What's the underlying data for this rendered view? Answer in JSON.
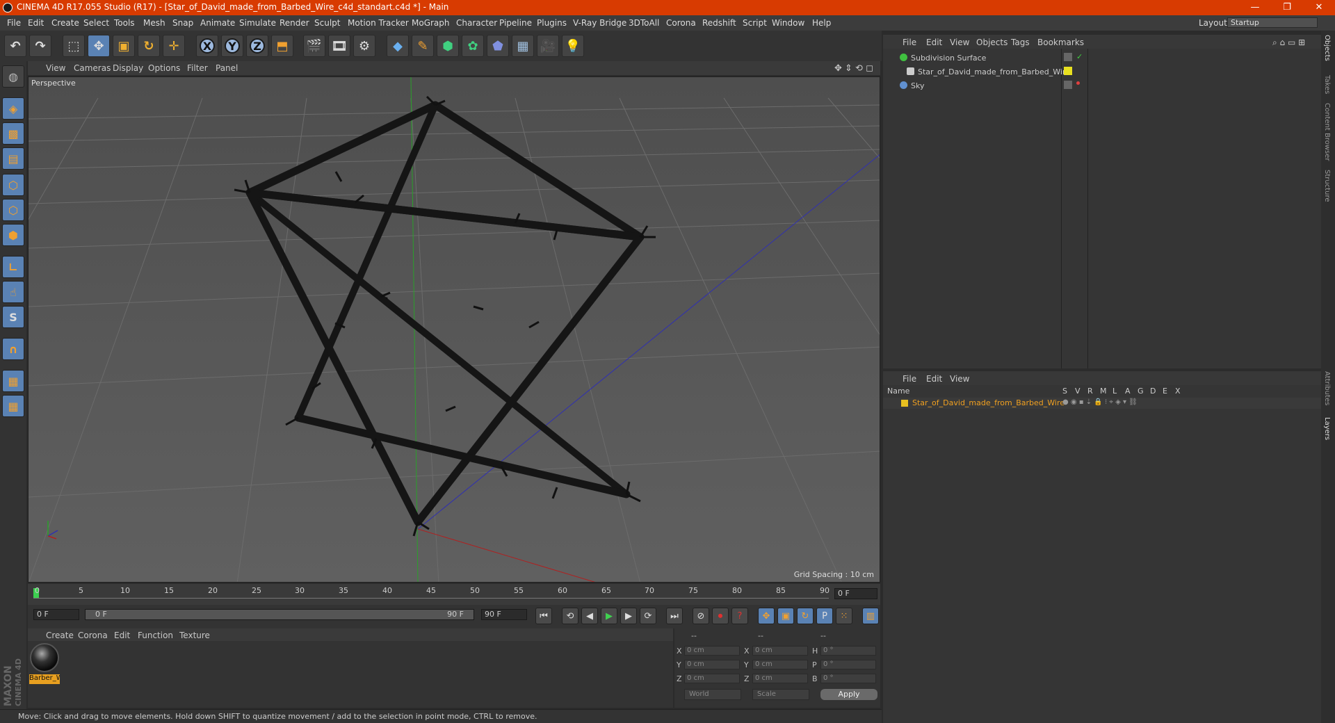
{
  "window": {
    "title": "CINEMA 4D R17.055 Studio (R17) - [Star_of_David_made_from_Barbed_Wire_c4d_standart.c4d *] - Main",
    "minimize": "—",
    "restore": "❐",
    "close": "✕"
  },
  "menubar": {
    "items": [
      "File",
      "Edit",
      "Create",
      "Select",
      "Tools",
      "Mesh",
      "Snap",
      "Animate",
      "Simulate",
      "Render",
      "Sculpt",
      "Motion Tracker",
      "MoGraph",
      "Character",
      "Pipeline",
      "Plugins",
      "V-Ray Bridge",
      "3DToAll",
      "Corona",
      "Redshift",
      "Script",
      "Window",
      "Help"
    ],
    "layout_label": "Layout:",
    "layout_value": "Startup"
  },
  "toolbar": {
    "axis_x": "X",
    "axis_y": "Y",
    "axis_z": "Z"
  },
  "viewport": {
    "menu": [
      "View",
      "Cameras",
      "Display",
      "Options",
      "Filter",
      "Panel"
    ],
    "camera_label": "Perspective",
    "grid_spacing": "Grid Spacing : 10 cm",
    "axis_colors": {
      "x": "#c02020",
      "y": "#20a020",
      "z": "#2020c0"
    }
  },
  "timeline": {
    "ticks": [
      "0",
      "5",
      "10",
      "15",
      "20",
      "25",
      "30",
      "35",
      "40",
      "45",
      "50",
      "55",
      "60",
      "65",
      "70",
      "75",
      "80",
      "85",
      "90"
    ],
    "current_frame": "0 F"
  },
  "transport": {
    "start_frame": "0 F",
    "range_start": "0 F",
    "range_end": "90 F",
    "end_frame": "90 F"
  },
  "material_manager": {
    "menu": [
      "Create",
      "Corona",
      "Edit",
      "Function",
      "Texture"
    ],
    "materials": [
      {
        "name": "Barber_W"
      }
    ]
  },
  "coordinates": {
    "header": [
      "--",
      "--",
      "--"
    ],
    "rows": [
      {
        "pos_label": "X",
        "pos": "0 cm",
        "size_label": "X",
        "size": "0 cm",
        "rot_label": "H",
        "rot": "0 °"
      },
      {
        "pos_label": "Y",
        "pos": "0 cm",
        "size_label": "Y",
        "size": "0 cm",
        "rot_label": "P",
        "rot": "0 °"
      },
      {
        "pos_label": "Z",
        "pos": "0 cm",
        "size_label": "Z",
        "size": "0 cm",
        "rot_label": "B",
        "rot": "0 °"
      }
    ],
    "mode": "World",
    "transform": "Scale",
    "apply": "Apply"
  },
  "object_manager": {
    "menu": [
      "File",
      "Edit",
      "View",
      "Objects",
      "Tags",
      "Bookmarks"
    ],
    "objects": [
      {
        "name": "Subdivision Surface",
        "color": "#40c040"
      },
      {
        "name": "Star_of_David_made_from_Barbed_Wire",
        "color": "#e8e020"
      },
      {
        "name": "Sky",
        "color": "#6090d0"
      }
    ]
  },
  "layer_manager": {
    "menu": [
      "File",
      "Edit",
      "View"
    ],
    "columns": [
      "Name",
      "S",
      "V",
      "R",
      "M",
      "L",
      "A",
      "G",
      "D",
      "E",
      "X"
    ],
    "layers": [
      {
        "name": "Star_of_David_made_from_Barbed_Wire",
        "color": "#e8c020"
      }
    ]
  },
  "side_tabs": [
    "Objects",
    "Takes",
    "Content Browser",
    "Structure",
    "Attributes",
    "Layers"
  ],
  "status": {
    "text": "Move: Click and drag to move elements. Hold down SHIFT to quantize movement / add to the selection in point mode, CTRL to remove."
  },
  "branding": {
    "line1": "MAXON",
    "line2": "CINEMA 4D"
  }
}
